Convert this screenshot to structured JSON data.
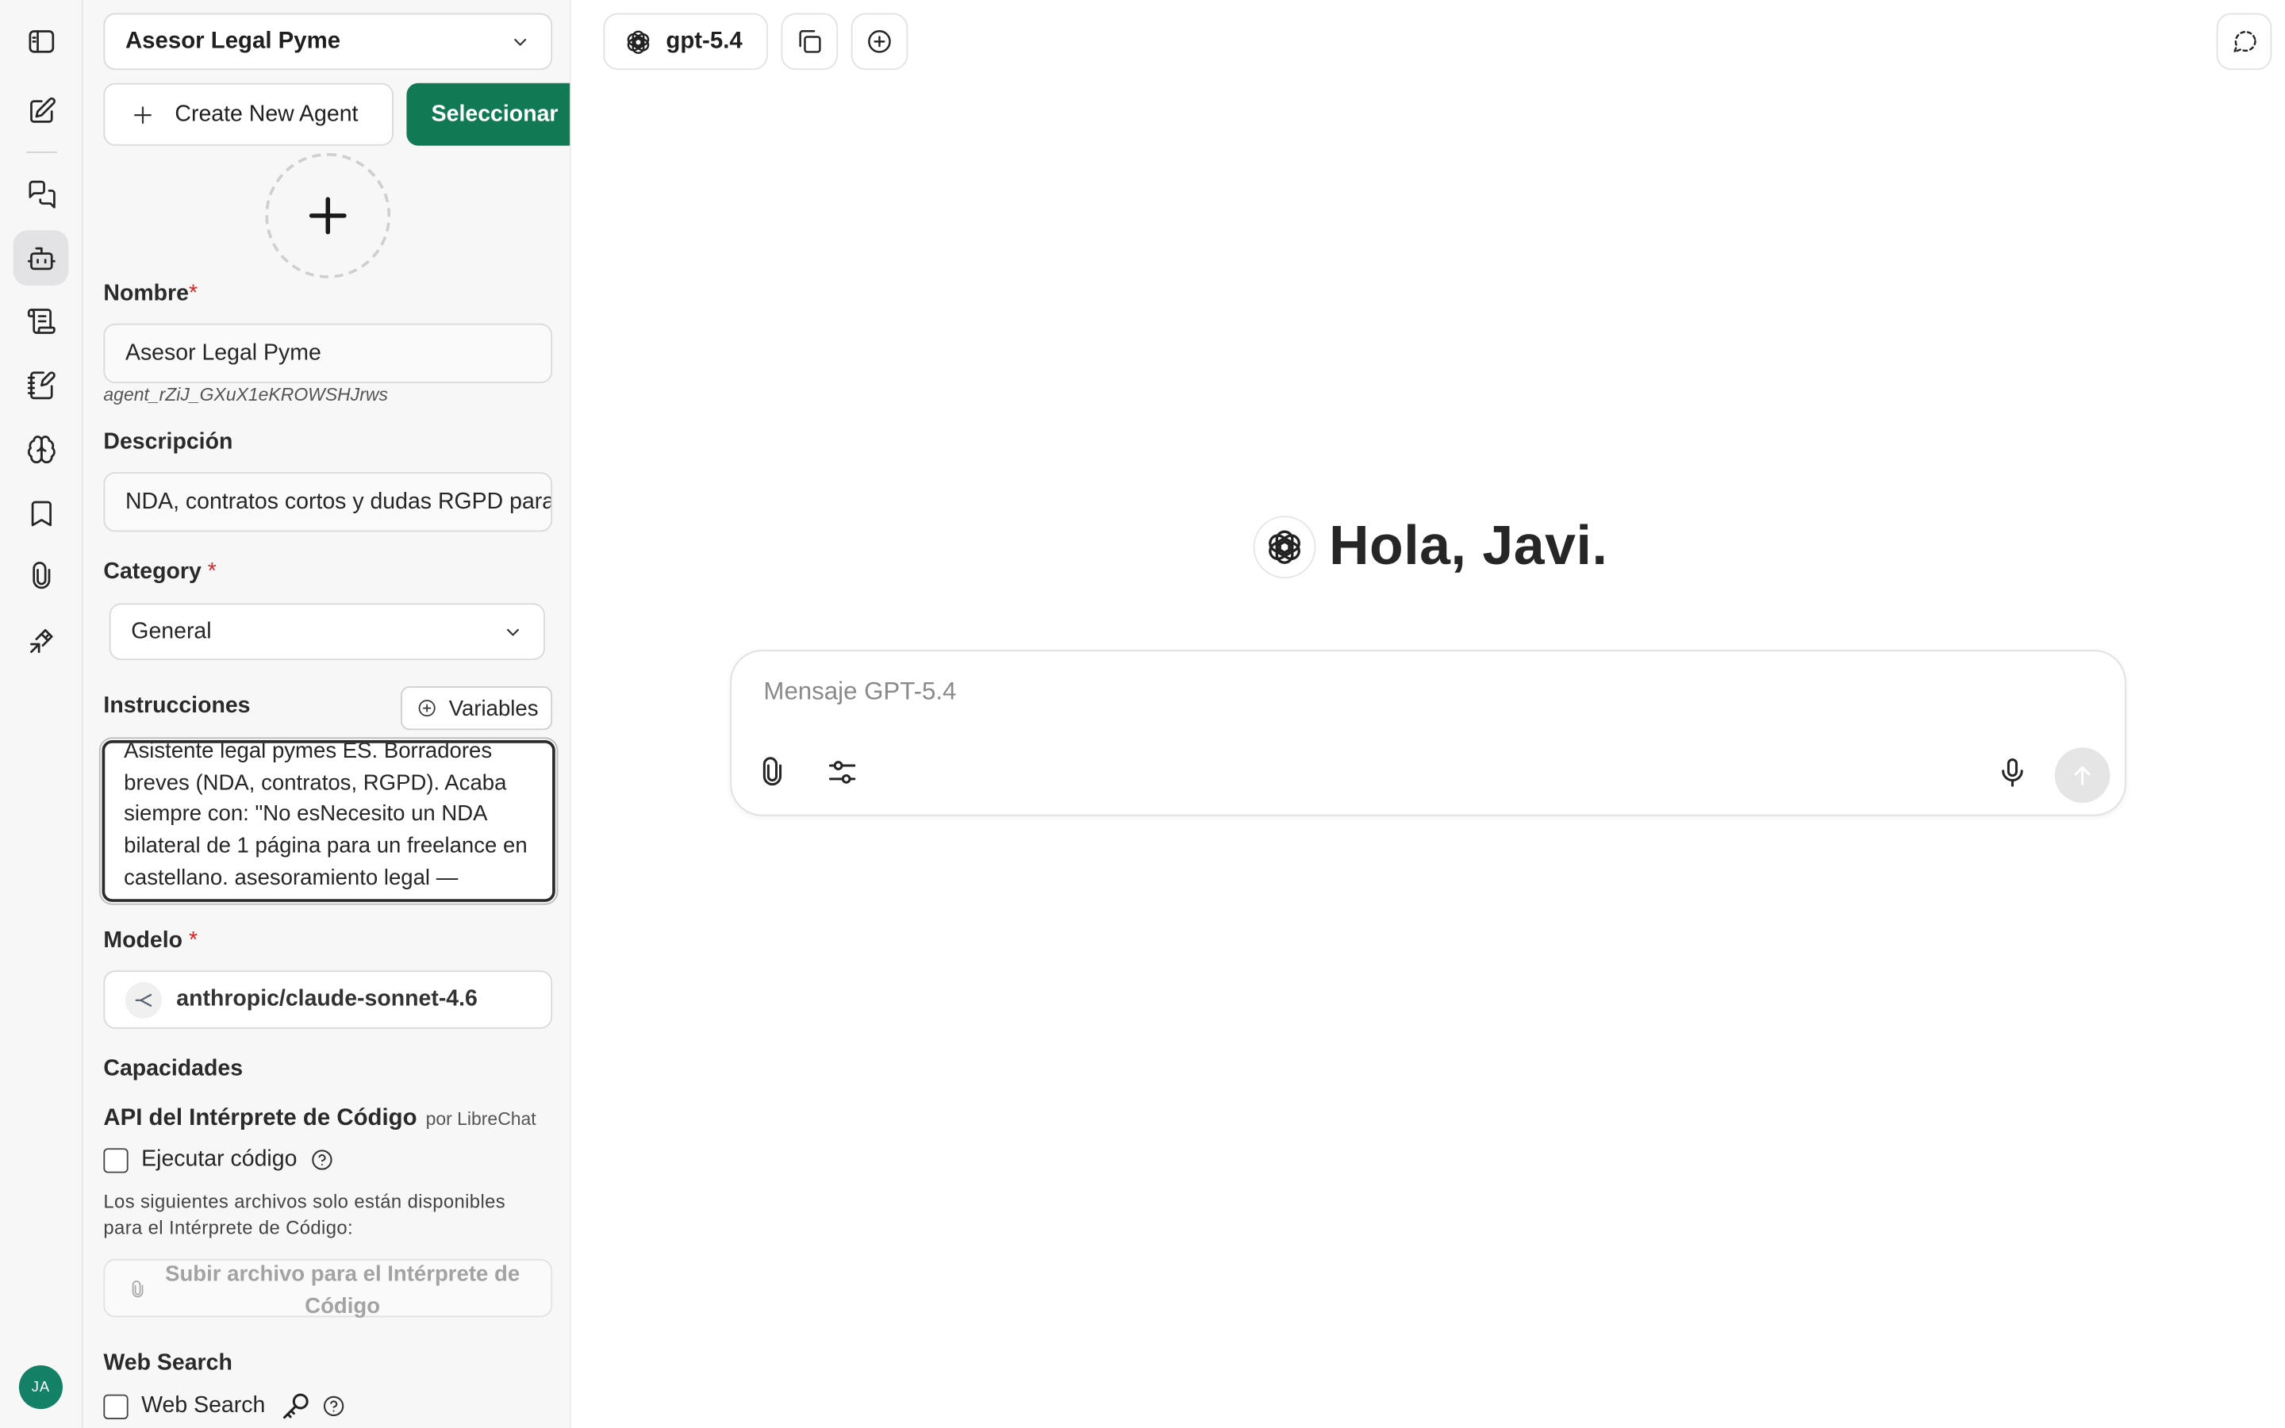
{
  "rail": {
    "items": [
      "sidebar-toggle-icon",
      "new-chat-icon",
      "chats-icon",
      "agents-icon",
      "prompts-icon",
      "memory-edit-icon",
      "brain-icon",
      "bookmark-icon",
      "attach-icon",
      "tools-icon"
    ],
    "avatar_initials": "JA"
  },
  "panel": {
    "agent_selected": "Asesor Legal Pyme",
    "create_label": "Create New Agent",
    "select_label": "Seleccionar",
    "name_label": "Nombre",
    "name_value": "Asesor Legal Pyme",
    "agent_id": "agent_rZiJ_GXuX1eKROWSHJrws",
    "description_label": "Descripción",
    "description_value": "NDA, contratos cortos y dudas RGPD para pymes",
    "category_label": "Category",
    "category_value": "General",
    "instructions_label": "Instrucciones",
    "variables_label": "Variables",
    "instructions_value": "Asistente legal pymes ES. Borradores breves (NDA, contratos, RGPD). Acaba siempre con: \"No esNecesito un NDA bilateral de 1 página para un freelance en castellano. asesoramiento legal —",
    "model_label": "Modelo",
    "model_value": "anthropic/claude-sonnet-4.6",
    "capabilities_label": "Capacidades",
    "code_api_label": "API del Intérprete de Código",
    "code_api_by": "por LibreChat",
    "run_code_label": "Ejecutar código",
    "files_note": "Los siguientes archivos solo están disponibles para el Intérprete de Código:",
    "upload_label": "Subir archivo para el Intérprete de Código",
    "web_search_title": "Web Search",
    "web_search_label": "Web Search",
    "required_mark": "*"
  },
  "main": {
    "model_name": "gpt-5.4",
    "greeting": "Hola, Javi.",
    "placeholder": "Mensaje GPT-5.4"
  },
  "colors": {
    "accent": "#117a55",
    "avatar": "#148066",
    "required": "#dc2626"
  }
}
